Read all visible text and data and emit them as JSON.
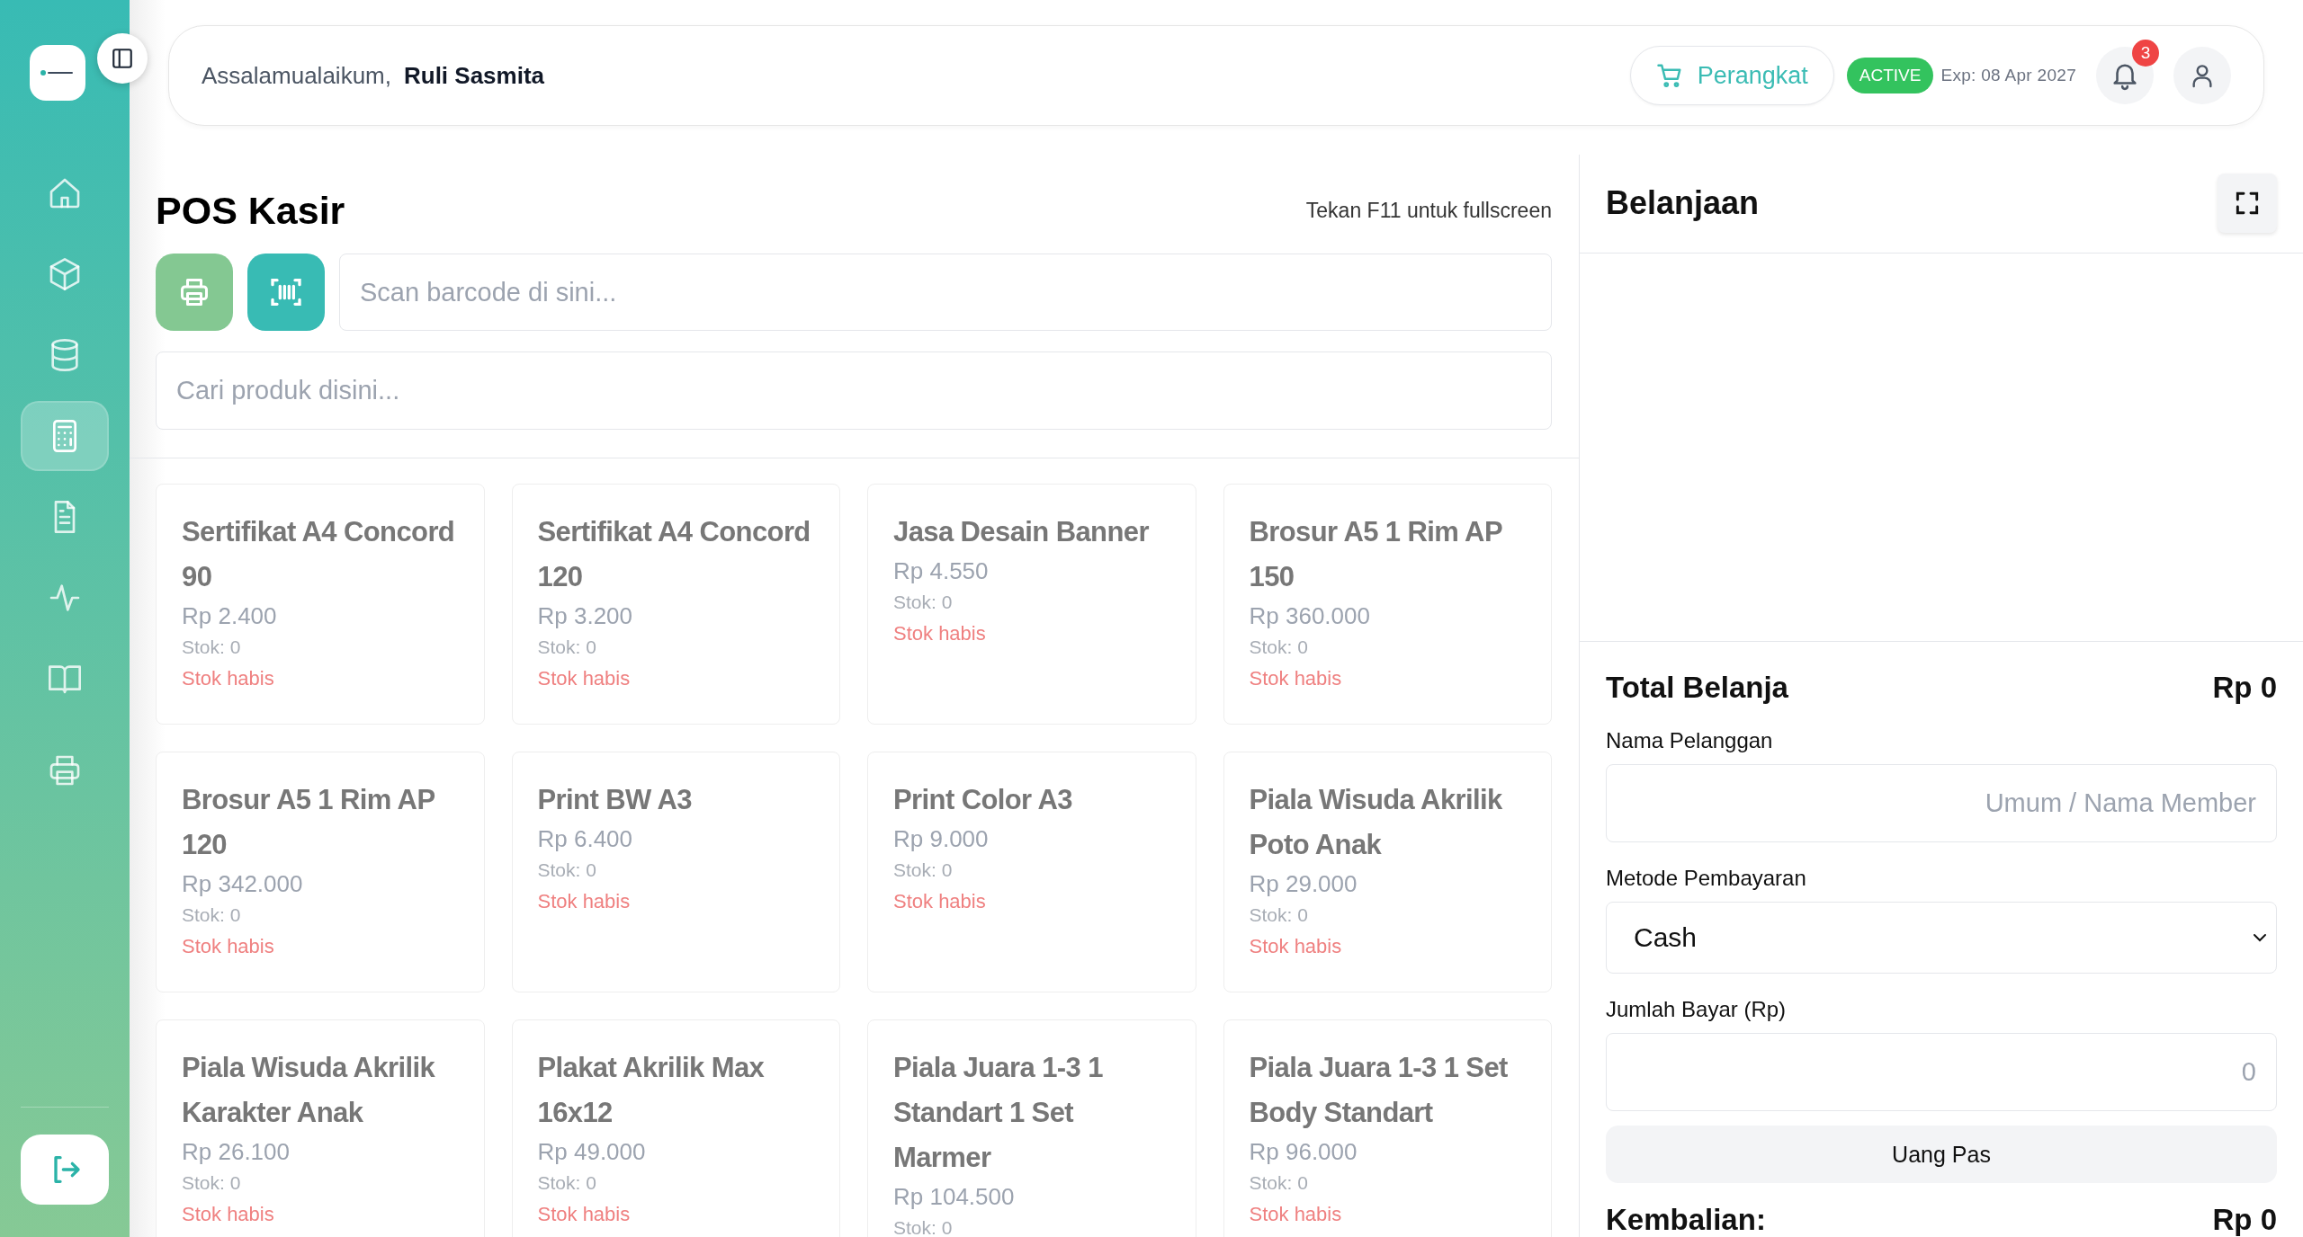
{
  "sidebar": {
    "items": [
      {
        "selected": false
      },
      {
        "selected": false
      },
      {
        "selected": false
      },
      {
        "selected": true
      },
      {
        "selected": false
      },
      {
        "selected": false
      },
      {
        "selected": false
      },
      {
        "selected": false
      }
    ]
  },
  "header": {
    "greeting": "Assalamualaikum,",
    "user_name": "Ruli Sasmita",
    "device_button": "Perangkat",
    "license": {
      "status": "ACTIVE",
      "expiry": "Exp: 08 Apr 2027"
    },
    "notification_count": "3"
  },
  "pos": {
    "title": "POS Kasir",
    "hint": "Tekan F11 untuk fullscreen",
    "scan_field": {
      "placeholder": "Scan barcode di sini..."
    },
    "search_field": {
      "placeholder": "Cari produk disini..."
    },
    "products": [
      {
        "name": "Sertifikat A4 Concord 90",
        "price": "Rp 2.400",
        "stock": "Stok: 0",
        "status": "Stok habis"
      },
      {
        "name": "Sertifikat A4 Concord 120",
        "price": "Rp 3.200",
        "stock": "Stok: 0",
        "status": "Stok habis"
      },
      {
        "name": "Jasa Desain Banner",
        "price": "Rp 4.550",
        "stock": "Stok: 0",
        "status": "Stok habis"
      },
      {
        "name": "Brosur A5 1 Rim AP 150",
        "price": "Rp 360.000",
        "stock": "Stok: 0",
        "status": "Stok habis"
      },
      {
        "name": "Brosur A5 1 Rim AP 120",
        "price": "Rp 342.000",
        "stock": "Stok: 0",
        "status": "Stok habis"
      },
      {
        "name": "Print BW A3",
        "price": "Rp 6.400",
        "stock": "Stok: 0",
        "status": "Stok habis"
      },
      {
        "name": "Print Color A3",
        "price": "Rp 9.000",
        "stock": "Stok: 0",
        "status": "Stok habis"
      },
      {
        "name": "Piala Wisuda Akrilik Poto Anak",
        "price": "Rp 29.000",
        "stock": "Stok: 0",
        "status": "Stok habis"
      },
      {
        "name": "Piala Wisuda Akrilik Karakter Anak",
        "price": "Rp 26.100",
        "stock": "Stok: 0",
        "status": "Stok habis"
      },
      {
        "name": "Plakat Akrilik Max 16x12",
        "price": "Rp 49.000",
        "stock": "Stok: 0",
        "status": "Stok habis"
      },
      {
        "name": "Piala Juara 1-3 1 Standart 1 Set Marmer",
        "price": "Rp 104.500",
        "stock": "Stok: 0"
      },
      {
        "name": "Piala Juara 1-3 1 Set Body Standart",
        "price": "Rp 96.000",
        "stock": "Stok: 0",
        "status": "Stok habis"
      }
    ]
  },
  "cart": {
    "title": "Belanjaan",
    "total_label": "Total Belanja",
    "total_value": "Rp 0",
    "customer": {
      "label": "Nama Pelanggan",
      "placeholder": "Umum / Nama Member"
    },
    "payment_method": {
      "label": "Metode Pembayaran",
      "value": "Cash"
    },
    "amount_paid": {
      "label": "Jumlah Bayar (Rp)",
      "placeholder": "0"
    },
    "exact_button": "Uang Pas",
    "change_label": "Kembalian:",
    "change_value": "Rp 0"
  }
}
